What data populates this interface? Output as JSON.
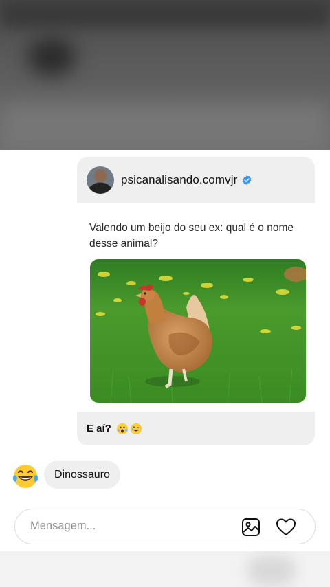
{
  "post": {
    "username": "psicanalisando.comvjr",
    "caption": "Valendo um beijo do seu ex: qual é o nome desse animal?",
    "footer_text": "E aí?"
  },
  "reply": {
    "text": "Dinossauro"
  },
  "composer": {
    "placeholder": "Mensagem..."
  },
  "icons": {
    "verified": "verified-badge-icon",
    "gallery": "image-gallery-icon",
    "heart": "heart-icon",
    "laugh": "laughing-tears-emoji"
  },
  "colors": {
    "verified_blue": "#3897f0",
    "bubble_bg": "#efefef"
  }
}
